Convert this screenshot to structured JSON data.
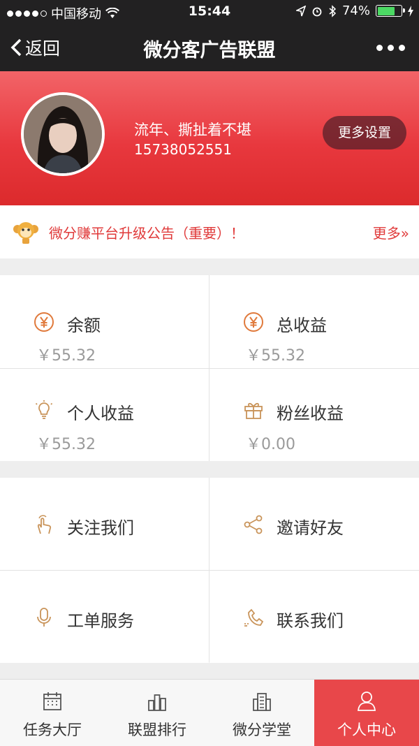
{
  "status_bar": {
    "carrier": "中国移动",
    "time": "15:44",
    "battery": "74%",
    "battery_level": 0.74
  },
  "nav": {
    "back_label": "返回",
    "title": "微分客广告联盟"
  },
  "profile": {
    "name": "流年、撕扯着不堪",
    "phone": "15738052551",
    "settings_label": "更多设置"
  },
  "notice": {
    "text": "微分赚平台升级公告（重要）！",
    "more_label": "更多»"
  },
  "stats": [
    {
      "label": "余额",
      "value": "￥55.32",
      "icon": "yuan-icon"
    },
    {
      "label": "总收益",
      "value": "￥55.32",
      "icon": "yuan-icon"
    },
    {
      "label": "个人收益",
      "value": "￥55.32",
      "icon": "lightbulb-icon"
    },
    {
      "label": "粉丝收益",
      "value": "￥0.00",
      "icon": "gift-icon"
    }
  ],
  "actions": [
    {
      "label": "关注我们",
      "icon": "tap-hand-icon"
    },
    {
      "label": "邀请好友",
      "icon": "share-icon"
    },
    {
      "label": "工单服务",
      "icon": "microphone-icon"
    },
    {
      "label": "联系我们",
      "icon": "phone-icon"
    }
  ],
  "tabs": [
    {
      "label": "任务大厅",
      "icon": "calendar-icon"
    },
    {
      "label": "联盟排行",
      "icon": "ranking-icon"
    },
    {
      "label": "微分学堂",
      "icon": "building-icon"
    },
    {
      "label": "个人中心",
      "icon": "user-icon",
      "active": true
    }
  ],
  "colors": {
    "accent": "#e8383e",
    "icon_orange": "#e07a3c",
    "icon_tan": "#c9945a"
  }
}
